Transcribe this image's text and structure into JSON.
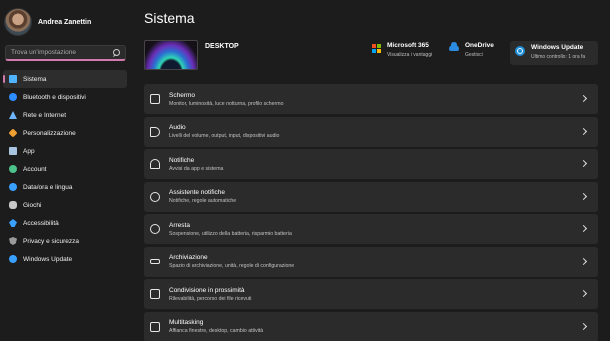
{
  "profile": {
    "name": "Andrea Zanettin"
  },
  "search": {
    "placeholder": "Trova un'impostazione"
  },
  "sidebar": {
    "items": [
      {
        "label": "Sistema",
        "icon": "system-icon",
        "color": "#4fb3ff",
        "active": true
      },
      {
        "label": "Bluetooth e dispositivi",
        "icon": "bluetooth-icon",
        "color": "#2d8cff"
      },
      {
        "label": "Rete e Internet",
        "icon": "network-icon",
        "color": "#6db6ff"
      },
      {
        "label": "Personalizzazione",
        "icon": "brush-icon",
        "color": "#f0a030"
      },
      {
        "label": "App",
        "icon": "apps-icon",
        "color": "#a8c4e0"
      },
      {
        "label": "Account",
        "icon": "account-icon",
        "color": "#4cc38a"
      },
      {
        "label": "Data/ora e lingua",
        "icon": "globe-clock-icon",
        "color": "#3aa0ff"
      },
      {
        "label": "Giochi",
        "icon": "gamepad-icon",
        "color": "#c8c8c8"
      },
      {
        "label": "Accessibilità",
        "icon": "accessibility-icon",
        "color": "#3aa0ff"
      },
      {
        "label": "Privacy e sicurezza",
        "icon": "shield-icon",
        "color": "#9a9a9a"
      },
      {
        "label": "Windows Update",
        "icon": "update-icon",
        "color": "#3aa0ff"
      }
    ]
  },
  "header": {
    "title": "Sistema"
  },
  "device": {
    "name": "DESKTOP"
  },
  "quick_links": [
    {
      "title": "Microsoft 365",
      "subtitle": "Visualizza i vantaggi",
      "icon": "microsoft-365-icon"
    },
    {
      "title": "OneDrive",
      "subtitle": "Gestisci",
      "icon": "onedrive-icon"
    },
    {
      "title": "Windows Update",
      "subtitle": "Ultimo controllo: 1 ora fa",
      "icon": "windows-update-icon"
    }
  ],
  "settings": [
    {
      "title": "Schermo",
      "subtitle": "Monitor, luminosità, luce notturna, profilo schermo",
      "icon": "display-icon"
    },
    {
      "title": "Audio",
      "subtitle": "Livelli del volume, output, input, dispositivi audio",
      "icon": "speaker-icon"
    },
    {
      "title": "Notifiche",
      "subtitle": "Avvisi da app e sistema",
      "icon": "bell-icon"
    },
    {
      "title": "Assistente notifiche",
      "subtitle": "Notifiche, regole automatiche",
      "icon": "moon-icon"
    },
    {
      "title": "Arresta",
      "subtitle": "Sospensione, utilizzo della batteria, risparmio batteria",
      "icon": "power-icon"
    },
    {
      "title": "Archiviazione",
      "subtitle": "Spazio di archiviazione, unità, regole di configurazione",
      "icon": "storage-icon"
    },
    {
      "title": "Condivisione in prossimità",
      "subtitle": "Rilevabilità, percorso dei file ricevuti",
      "icon": "share-icon"
    },
    {
      "title": "Multitasking",
      "subtitle": "Affianca finestre, desktop, cambio attività",
      "icon": "multitasking-icon"
    }
  ]
}
